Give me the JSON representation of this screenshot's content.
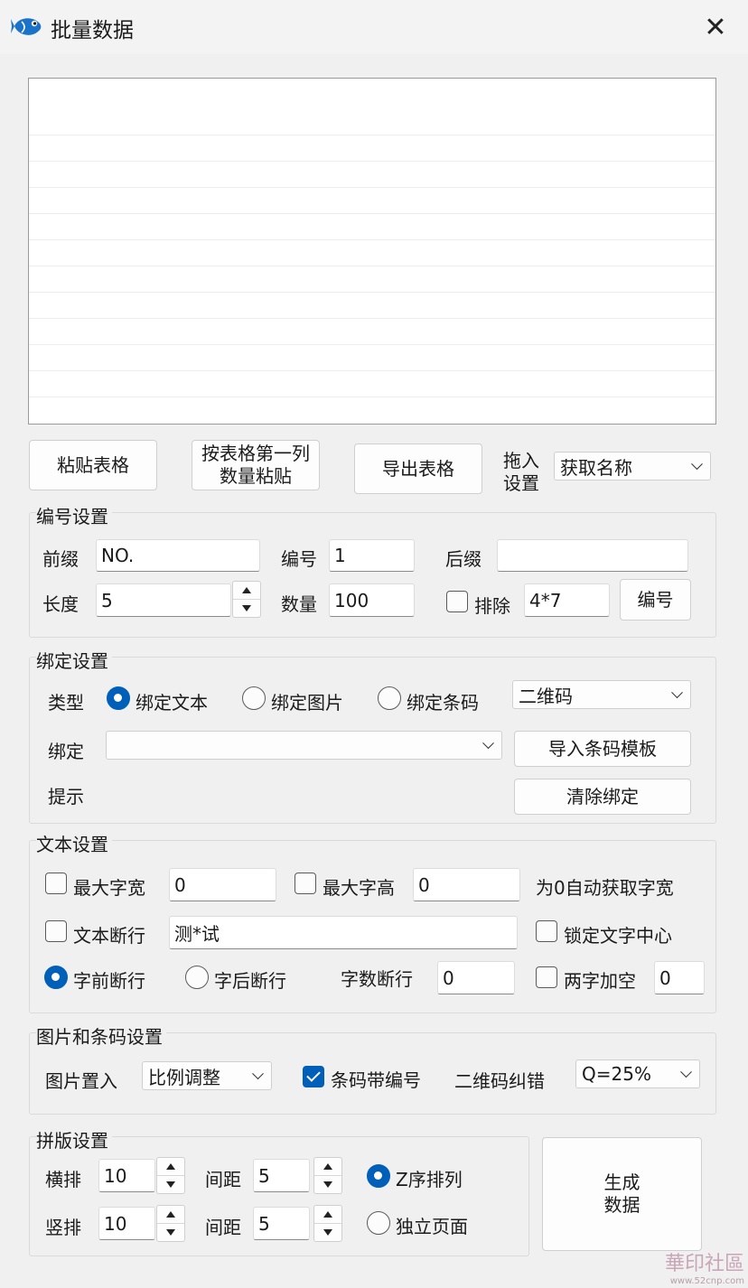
{
  "window": {
    "title": "批量数据",
    "close": "✕"
  },
  "actions": {
    "paste_table": "粘贴表格",
    "paste_by_first_col_line1": "按表格第一列",
    "paste_by_first_col_line2": "数量粘贴",
    "export_table": "导出表格",
    "drag_label_line1": "拖入",
    "drag_label_line2": "设置",
    "drag_select": "获取名称"
  },
  "numbering": {
    "title": "编号设置",
    "prefix_label": "前缀",
    "prefix_value": "NO.",
    "number_label": "编号",
    "number_value": "1",
    "suffix_label": "后缀",
    "suffix_value": "",
    "length_label": "长度",
    "length_value": "5",
    "count_label": "数量",
    "count_value": "100",
    "exclude_label": "排除",
    "exclude_value": "4*7",
    "exclude_checked": false,
    "number_button": "编号"
  },
  "binding": {
    "title": "绑定设置",
    "type_label": "类型",
    "bind_text": "绑定文本",
    "bind_image": "绑定图片",
    "bind_barcode": "绑定条码",
    "selected": "text",
    "barcode_type": "二维码",
    "bind_label": "绑定",
    "bind_value": "",
    "import_template": "导入条码模板",
    "hint_label": "提示",
    "clear_binding": "清除绑定"
  },
  "text": {
    "title": "文本设置",
    "max_width_label": "最大字宽",
    "max_width_value": "0",
    "max_height_label": "最大字高",
    "max_height_value": "0",
    "auto_note": "为0自动获取字宽",
    "wrap_label": "文本断行",
    "wrap_value": "测*试",
    "lock_center_label": "锁定文字中心",
    "break_before": "字前断行",
    "break_after": "字后断行",
    "char_count_label": "字数断行",
    "char_count_value": "0",
    "two_char_space_label": "两字加空",
    "two_char_space_value": "0"
  },
  "image_barcode": {
    "title": "图片和条码设置",
    "image_place_label": "图片置入",
    "image_place_value": "比例调整",
    "barcode_number_label": "条码带编号",
    "barcode_number_checked": true,
    "qr_ecc_label": "二维码纠错",
    "qr_ecc_value": "Q=25%"
  },
  "layout": {
    "title": "拼版设置",
    "horizontal_label": "横排",
    "horizontal_value": "10",
    "h_gap_label": "间距",
    "h_gap_value": "5",
    "vertical_label": "竖排",
    "vertical_value": "10",
    "v_gap_label": "间距",
    "v_gap_value": "5",
    "z_order_label": "Z序排列",
    "standalone_label": "独立页面",
    "generate_line1": "生成",
    "generate_line2": "数据"
  },
  "watermark": {
    "main": "華印社區",
    "sub": "www.52cnp.com"
  }
}
